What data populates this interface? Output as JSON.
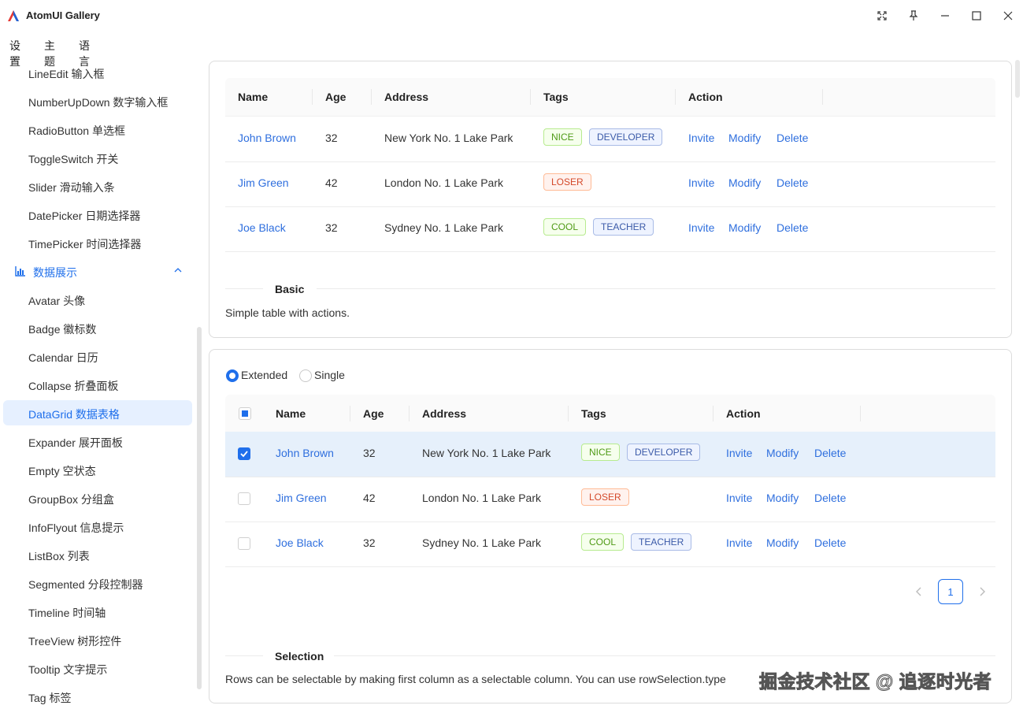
{
  "window": {
    "title": "AtomUI Gallery"
  },
  "menu": [
    "设置",
    "主题",
    "语言"
  ],
  "sidebar": {
    "items_top": [
      "LineEdit 输入框",
      "NumberUpDown 数字输入框",
      "RadioButton 单选框",
      "ToggleSwitch 开关",
      "Slider 滑动输入条",
      "DatePicker 日期选择器",
      "TimePicker 时间选择器"
    ],
    "group": {
      "label": "数据展示",
      "icon": "chart-icon"
    },
    "items_group": [
      "Avatar 头像",
      "Badge 徽标数",
      "Calendar 日历",
      "Collapse 折叠面板",
      "DataGrid 数据表格",
      "Expander 展开面板",
      "Empty 空状态",
      "GroupBox 分组盒",
      "InfoFlyout 信息提示",
      "ListBox 列表",
      "Segmented 分段控制器",
      "Timeline 时间轴",
      "TreeView 树形控件",
      "Tooltip 文字提示",
      "Tag 标签"
    ],
    "active_index": 4
  },
  "columns": [
    "Name",
    "Age",
    "Address",
    "Tags",
    "Action"
  ],
  "rows": [
    {
      "name": "John Brown",
      "age": "32",
      "address": "New York No. 1 Lake Park",
      "tags": [
        {
          "text": "NICE",
          "color": "green"
        },
        {
          "text": "DEVELOPER",
          "color": "blue"
        }
      ]
    },
    {
      "name": "Jim Green",
      "age": "42",
      "address": "London No. 1 Lake Park",
      "tags": [
        {
          "text": "LOSER",
          "color": "red"
        }
      ]
    },
    {
      "name": "Joe Black",
      "age": "32",
      "address": "Sydney No. 1 Lake Park",
      "tags": [
        {
          "text": "COOL",
          "color": "green"
        },
        {
          "text": "TEACHER",
          "color": "blue"
        }
      ]
    }
  ],
  "actions": [
    "Invite",
    "Modify",
    "Delete"
  ],
  "basic": {
    "title": "Basic",
    "desc": "Simple table with actions."
  },
  "selection": {
    "mode_options": [
      "Extended",
      "Single"
    ],
    "selected_mode": "Extended",
    "selected_rows": [
      true,
      false,
      false
    ],
    "header_checkbox": "indeterminate",
    "title": "Selection",
    "desc": "Rows can be selectable by making first column as a selectable column. You can use rowSelection.type",
    "page": "1"
  },
  "watermark": "掘金技术社区 @ 追逐时光者",
  "colors": {
    "accent": "#1f6feb",
    "link": "#2f6fde"
  }
}
